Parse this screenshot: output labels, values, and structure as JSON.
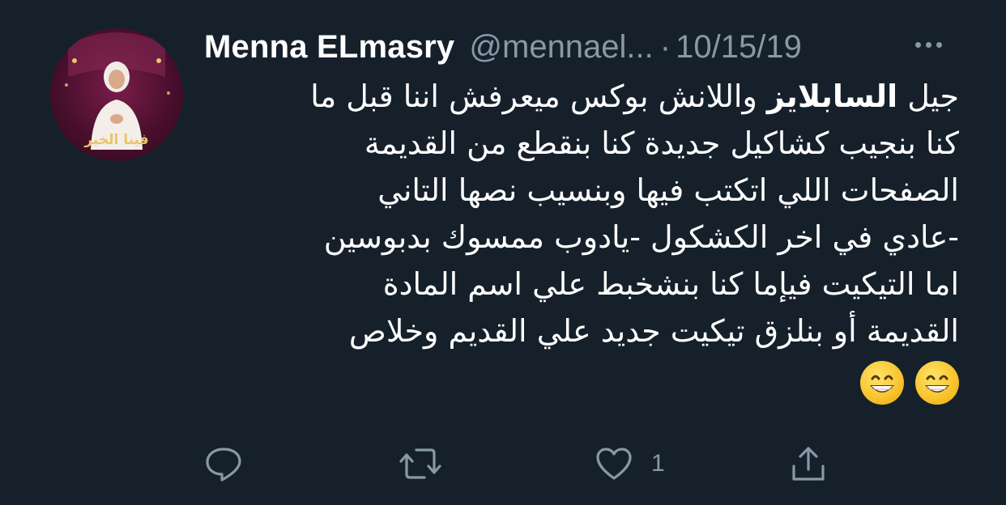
{
  "tweet": {
    "display_name": "Menna ELmasry",
    "handle": "@mennael...",
    "separator": "·",
    "date": "10/15/19",
    "avatar_caption": "فينا الخير",
    "text_lines": [
      {
        "before": "جيل ",
        "bold": "السابلايز",
        "after": " واللانش بوكس ميعرفش اننا قبل ما"
      },
      {
        "before": "كنا بنجيب كشاكيل جديدة كنا بنقطع من القديمة",
        "bold": "",
        "after": ""
      },
      {
        "before": "الصفحات اللي اتكتب فيها وبنسيب نصها التاني",
        "bold": "",
        "after": ""
      },
      {
        "before": "-عادي في اخر الكشكول -يادوب ممسوك بدبوسين",
        "bold": "",
        "after": ""
      },
      {
        "before": "اما التيكيت فيإما كنا بنشخبط علي اسم المادة",
        "bold": "",
        "after": ""
      },
      {
        "before": "القديمة أو بنلزق تيكيت جديد علي القديم وخلاص",
        "bold": "",
        "after": ""
      }
    ],
    "emoji_count": 2
  },
  "actions": {
    "reply": {
      "icon": "reply-icon",
      "count": ""
    },
    "retweet": {
      "icon": "retweet-icon",
      "count": ""
    },
    "like": {
      "icon": "heart-icon",
      "count": "1"
    },
    "share": {
      "icon": "share-icon",
      "count": ""
    }
  },
  "colors": {
    "background": "#15202b",
    "text": "#ffffff",
    "secondary": "#8899a6"
  }
}
